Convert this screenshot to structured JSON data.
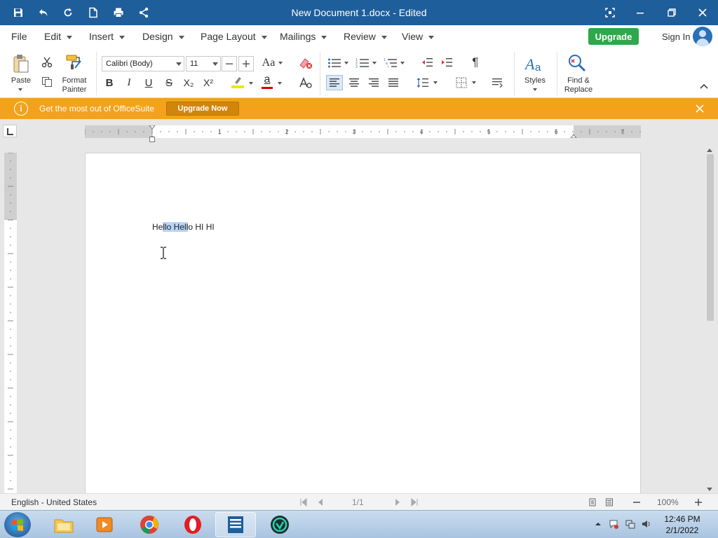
{
  "titlebar": {
    "title": "New Document 1.docx - Edited"
  },
  "menu": {
    "file": "File",
    "edit": "Edit",
    "insert": "Insert",
    "design": "Design",
    "page_layout": "Page Layout",
    "mailings": "Mailings",
    "review": "Review",
    "view": "View",
    "upgrade": "Upgrade",
    "sign_in": "Sign In"
  },
  "ribbon": {
    "paste": "Paste",
    "format_painter_1": "Format",
    "format_painter_2": "Painter",
    "font_name": "Calibri (Body)",
    "font_size": "11",
    "case_label": "Aa",
    "bold": "B",
    "italic": "I",
    "underline": "U",
    "strike": "S",
    "subscript": "X₂",
    "superscript": "X²",
    "highlight_glyph": "a",
    "font_color_glyph": "a",
    "styles": "Styles",
    "find_1": "Find &",
    "find_2": "Replace",
    "pilcrow": "¶"
  },
  "notification": {
    "message": "Get the most out of OfficeSuite",
    "button": "Upgrade Now"
  },
  "document": {
    "before_selection": "He",
    "selection": "llo Hell",
    "after_selection": "o HI HI"
  },
  "status": {
    "language": "English - United States",
    "page": "1/1",
    "zoom": "100%"
  },
  "taskbar": {
    "time": "12:46 PM",
    "date": "2/1/2022"
  },
  "colors": {
    "title_bar": "#1e5e9b",
    "upgrade": "#2ea84a",
    "notification": "#f4a21c",
    "selection": "#b8d5f5",
    "highlight_bar": "#f2e600",
    "font_color_bar": "#d40000"
  }
}
